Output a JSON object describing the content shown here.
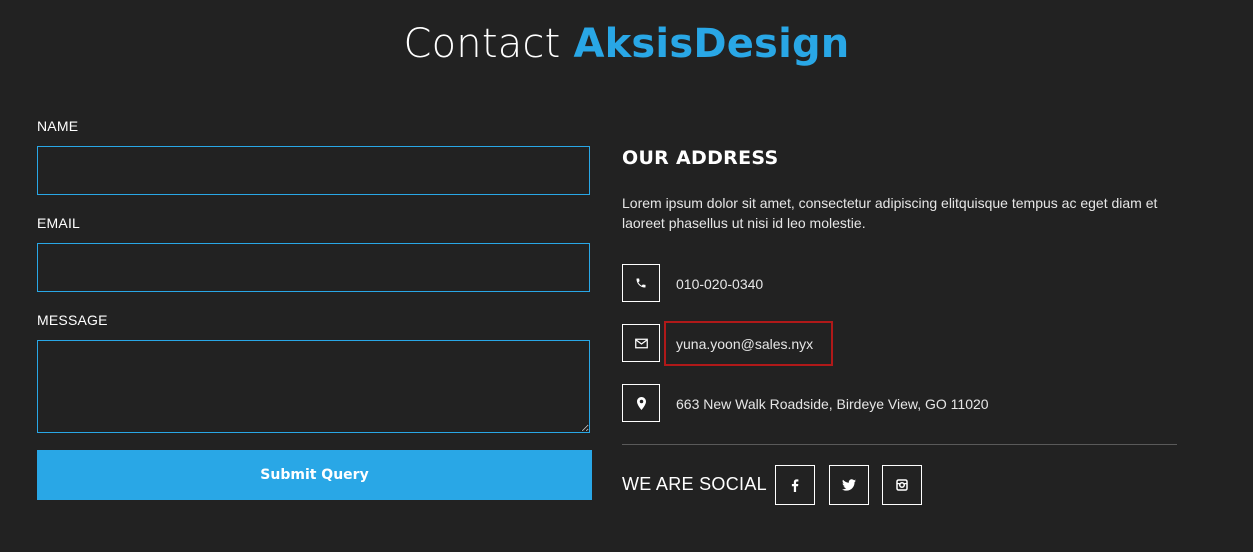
{
  "header": {
    "title_prefix": "Contact ",
    "title_brand": "AksisDesign"
  },
  "form": {
    "name_label": "NAME",
    "name_value": "",
    "email_label": "EMAIL",
    "email_value": "",
    "message_label": "MESSAGE",
    "message_value": "",
    "submit_label": "Submit Query"
  },
  "address": {
    "heading": "OUR ADDRESS",
    "description": "Lorem ipsum dolor sit amet, consectetur adipiscing elitquisque tempus ac eget diam et laoreet phasellus ut nisi id leo molestie.",
    "phone": "010-020-0340",
    "email": "yuna.yoon@sales.nyx",
    "location": "663 New Walk Roadside, Birdeye View, GO 11020"
  },
  "social": {
    "label": "WE ARE SOCIAL",
    "items": [
      "facebook-icon",
      "twitter-icon",
      "instagram-icon"
    ]
  },
  "colors": {
    "background": "#222222",
    "accent": "#29a7e6",
    "highlight": "#b01919"
  }
}
